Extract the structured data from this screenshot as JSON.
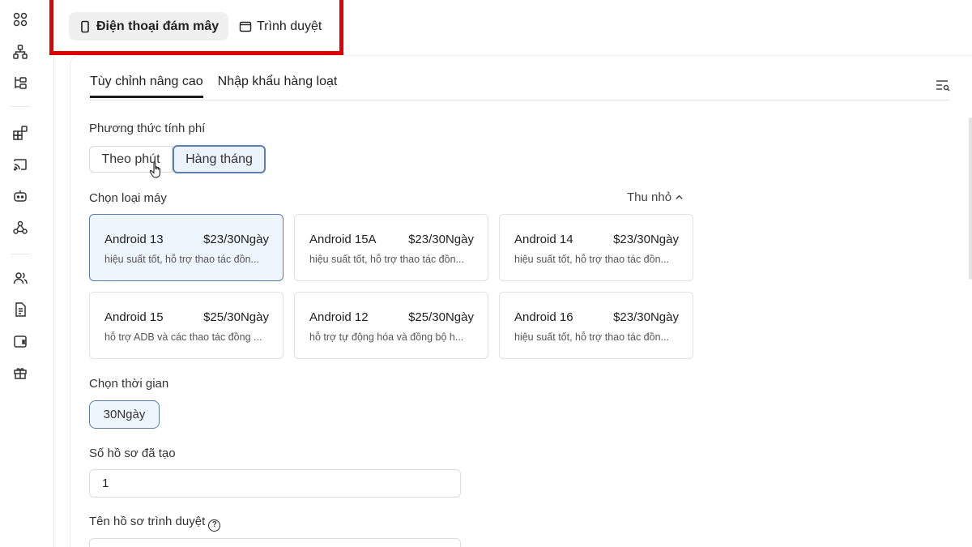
{
  "top_tabs": [
    {
      "label": "Điện thoại đám mây",
      "icon": "phone-icon",
      "active": true
    },
    {
      "label": "Trình duyệt",
      "icon": "browser-icon",
      "active": false
    }
  ],
  "sub_tabs": [
    {
      "label": "Tùy chỉnh nâng cao",
      "active": true
    },
    {
      "label": "Nhập khẩu hàng loạt",
      "active": false
    }
  ],
  "billing": {
    "label": "Phương thức tính phí",
    "options": [
      "Theo phút",
      "Hàng tháng"
    ],
    "selected": "Hàng tháng"
  },
  "machine_type": {
    "label": "Chọn loại máy",
    "collapse_label": "Thu nhỏ",
    "items": [
      {
        "name": "Android 13",
        "price": "$23/30Ngày",
        "desc": "hiệu suất tốt, hỗ trợ thao tác đồn...",
        "selected": true
      },
      {
        "name": "Android 15A",
        "price": "$23/30Ngày",
        "desc": "hiệu suất tốt, hỗ trợ thao tác đồn...",
        "selected": false
      },
      {
        "name": "Android 14",
        "price": "$23/30Ngày",
        "desc": "hiệu suất tốt, hỗ trợ thao tác đồn...",
        "selected": false
      },
      {
        "name": "Android 15",
        "price": "$25/30Ngày",
        "desc": "hỗ trợ ADB và các thao tác đồng ...",
        "selected": false
      },
      {
        "name": "Android 12",
        "price": "$25/30Ngày",
        "desc": "hỗ trợ tự động hóa và đồng bộ h...",
        "selected": false
      },
      {
        "name": "Android 16",
        "price": "$23/30Ngày",
        "desc": "hiệu suất tốt, hỗ trợ thao tác đồn...",
        "selected": false
      }
    ]
  },
  "duration": {
    "label": "Chọn thời gian",
    "selected": "30Ngày"
  },
  "profile_count": {
    "label": "Số hồ sơ đã tạo",
    "value": "1"
  },
  "profile_name": {
    "label": "Tên hồ sơ trình duyệt",
    "help_glyph": "?"
  },
  "colors": {
    "accent_border": "#5c7da8",
    "selected_bg": "#eef5fc",
    "highlight_red": "#e00000"
  }
}
